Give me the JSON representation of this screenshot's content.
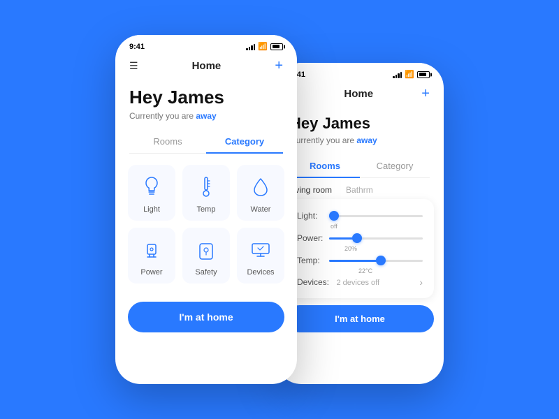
{
  "app": {
    "title": "Home",
    "time": "9:41"
  },
  "phone1": {
    "greeting": "Hey James",
    "status_prefix": "Currently you are ",
    "status_value": "away",
    "tabs": [
      {
        "label": "Rooms",
        "active": false
      },
      {
        "label": "Category",
        "active": true
      }
    ],
    "categories": [
      {
        "id": "light",
        "label": "Light",
        "icon": "light"
      },
      {
        "id": "temp",
        "label": "Temp",
        "icon": "temp"
      },
      {
        "id": "water",
        "label": "Water",
        "icon": "water"
      },
      {
        "id": "power",
        "label": "Power",
        "icon": "power"
      },
      {
        "id": "safety",
        "label": "Safety",
        "icon": "safety"
      },
      {
        "id": "devices",
        "label": "Devices",
        "icon": "devices"
      }
    ],
    "cta_button": "I'm at home"
  },
  "phone2": {
    "greeting": "Hey James",
    "status_prefix": "Currently you are ",
    "status_value": "away",
    "tabs": [
      {
        "label": "Rooms",
        "active": true
      },
      {
        "label": "Category",
        "active": false
      }
    ],
    "room_labels": [
      "Living room",
      "Bathrm"
    ],
    "controls": [
      {
        "label": "Light:",
        "value_text": "off",
        "fill_pct": 5
      },
      {
        "label": "Power:",
        "value_text": "20%",
        "fill_pct": 30
      },
      {
        "label": "Temp:",
        "value_text": "22°C",
        "fill_pct": 55
      }
    ],
    "devices_label": "Devices:",
    "devices_count": "2 devices off",
    "cta_button": "I'm at home"
  }
}
